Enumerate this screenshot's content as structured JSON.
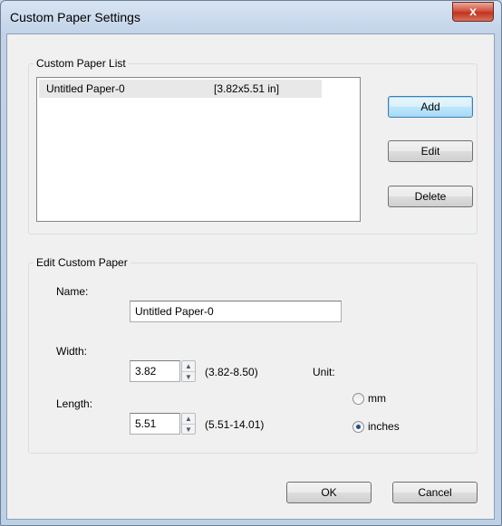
{
  "window": {
    "title": "Custom Paper Settings",
    "close_label": "x"
  },
  "paper_list": {
    "group_label": "Custom Paper List",
    "items": [
      {
        "name": "Untitled Paper-0",
        "size": "[3.82x5.51 in]"
      }
    ]
  },
  "buttons": {
    "add": "Add",
    "edit": "Edit",
    "delete": "Delete",
    "ok": "OK",
    "cancel": "Cancel"
  },
  "edit_paper": {
    "group_label": "Edit Custom Paper",
    "name_label": "Name:",
    "name_value": "Untitled Paper-0",
    "width_label": "Width:",
    "width_value": "3.82",
    "width_range": "(3.82-8.50)",
    "length_label": "Length:",
    "length_value": "5.51",
    "length_range": "(5.51-14.01)",
    "unit_label": "Unit:",
    "unit_options": [
      "mm",
      "inches"
    ],
    "unit_selected": "inches"
  },
  "icons": {
    "spin_up": "▲",
    "spin_down": "▼"
  },
  "colors": {
    "window_frame": "#bcd0e6",
    "close_button": "#c1331f",
    "default_button_border": "#3c7fb1",
    "selected_row": "#e8e8e8"
  }
}
